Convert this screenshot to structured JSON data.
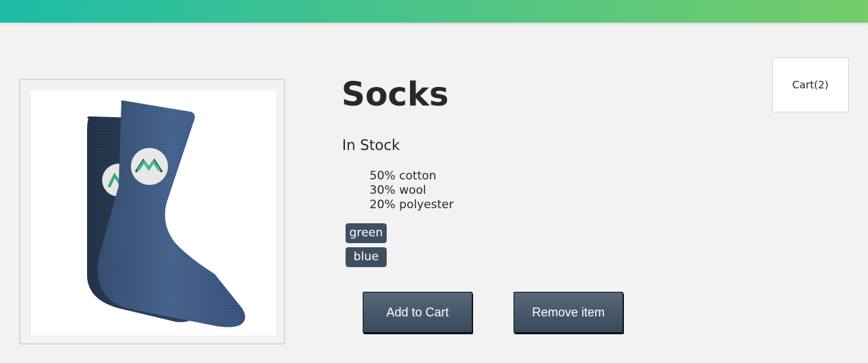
{
  "product": {
    "title": "Socks",
    "stock_status": "In Stock",
    "details": [
      "50% cotton",
      "30% wool",
      "20% polyester"
    ],
    "variants": [
      {
        "label": "green",
        "color": "#42b983"
      },
      {
        "label": "blue",
        "color": "#3e5e86"
      }
    ],
    "image": {
      "depicts": "blue-socks-with-logo",
      "logo_colors": [
        "#42b983",
        "#35495e"
      ]
    }
  },
  "actions": {
    "add_label": "Add to Cart",
    "remove_label": "Remove item"
  },
  "cart": {
    "label": "Cart(2)"
  },
  "theme": {
    "header_gradient": [
      "#1cbca8",
      "#75cc68"
    ],
    "button_color": "#3e4f62",
    "background": "#f2f2f2"
  }
}
